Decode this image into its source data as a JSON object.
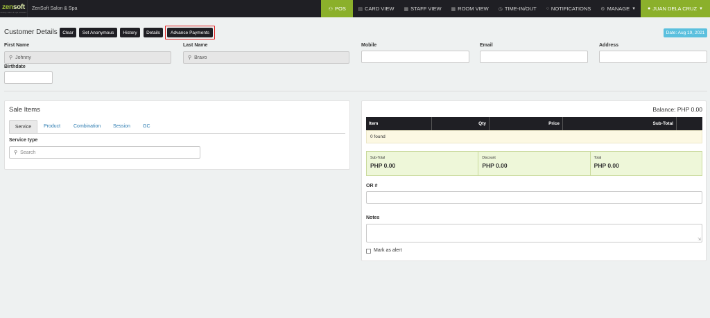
{
  "app": {
    "logo": "zensoft",
    "logo_part1": "zen",
    "logo_part2": "soft",
    "logo_sub": "beauty salon & spa software",
    "brand_name": "ZenSoft Salon & Spa"
  },
  "nav": {
    "items": [
      {
        "label": "POS",
        "icon": "user-plus-icon"
      },
      {
        "label": "CARD VIEW",
        "icon": "card-icon"
      },
      {
        "label": "STAFF VIEW",
        "icon": "calendar-icon"
      },
      {
        "label": "ROOM VIEW",
        "icon": "calendar-icon"
      },
      {
        "label": "TIME-IN/OUT",
        "icon": "clock-icon"
      },
      {
        "label": "NOTIFICATIONS",
        "icon": "bell-icon"
      },
      {
        "label": "MANAGE",
        "icon": "gear-icon"
      }
    ],
    "user": "JUAN DELA CRUZ",
    "active_color": "#8bb02b"
  },
  "customer": {
    "title": "Customer Details",
    "buttons": {
      "clear": "Clear",
      "anonymous": "Set Anonymous",
      "history": "History",
      "details": "Details",
      "advance": "Advance Payments"
    },
    "date": "Date: Aug 19, 2021",
    "fields": {
      "first_name_label": "First Name",
      "first_name": "Johnny",
      "last_name_label": "Last Name",
      "last_name": "Bravo",
      "mobile_label": "Mobile",
      "mobile": "",
      "email_label": "Email",
      "email": "",
      "address_label": "Address",
      "address": "",
      "birthdate_label": "Birthdate",
      "birthdate": ""
    }
  },
  "sale_items": {
    "title": "Sale Items",
    "tabs": [
      "Service",
      "Product",
      "Combination",
      "Session",
      "GC"
    ],
    "service_type_label": "Service type",
    "search_placeholder": "Search"
  },
  "cart": {
    "balance": "Balance: PHP 0.00",
    "columns": [
      "Item",
      "Qty",
      "Price",
      "Sub-Total"
    ],
    "found_text": "0 found",
    "totals": [
      {
        "label": "Sub-Total",
        "value": "PHP 0.00"
      },
      {
        "label": "Discount",
        "value": "PHP 0.00"
      },
      {
        "label": "Total",
        "value": "PHP 0.00"
      }
    ],
    "or_label": "OR #",
    "or_value": "",
    "notes_label": "Notes",
    "notes_value": "",
    "alert_label": "Mark as alert"
  }
}
